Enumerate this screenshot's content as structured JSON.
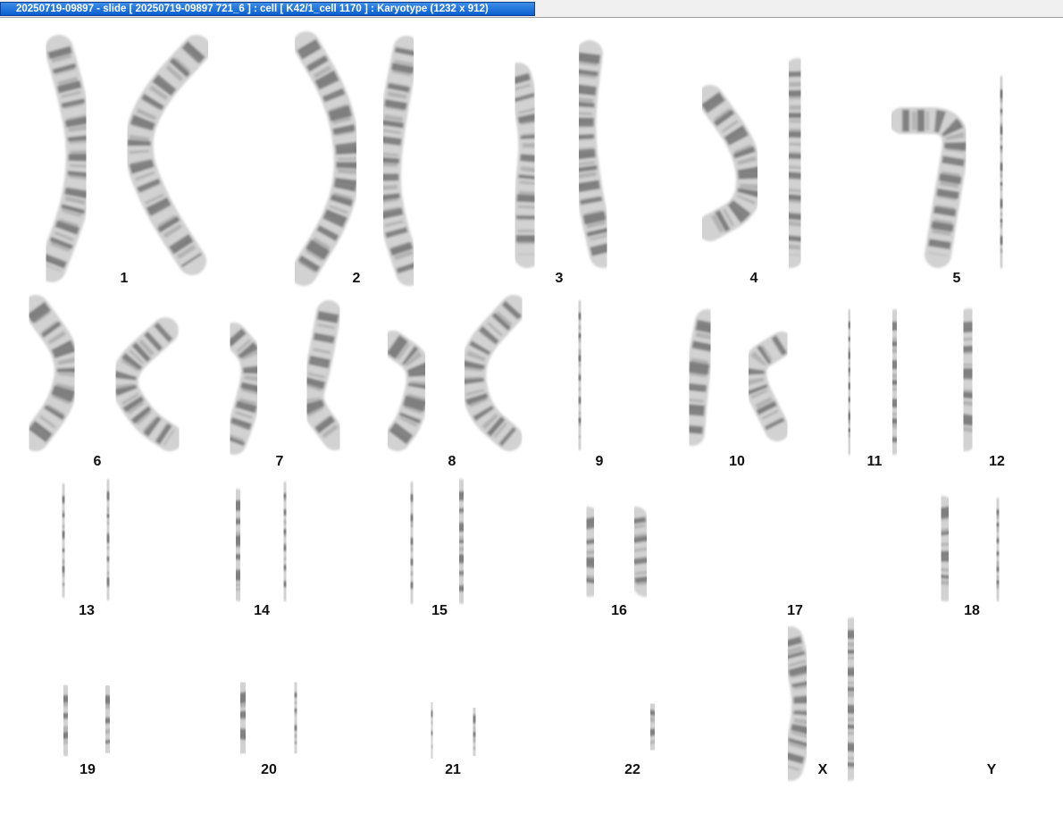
{
  "window": {
    "title": "20250719-09897 - slide [ 20250719-09897 721_6 ] : cell [ K42/1_cell 1170 ] : Karyotype  (1232 x 912)"
  },
  "karyotype": {
    "labels": [
      "1",
      "2",
      "3",
      "4",
      "5",
      "6",
      "7",
      "8",
      "9",
      "10",
      "11",
      "12",
      "13",
      "14",
      "15",
      "16",
      "17",
      "18",
      "19",
      "20",
      "21",
      "22",
      "X",
      "Y"
    ]
  },
  "colors": {
    "titlebar_accent": "#0a5fd1",
    "chromosome_light": "#d2d2d2",
    "chromosome_dark": "#3a3a3a"
  }
}
